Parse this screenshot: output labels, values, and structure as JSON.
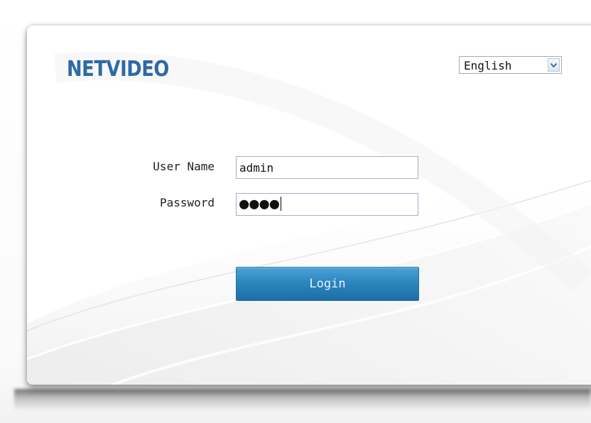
{
  "brand": {
    "logo_text": "NETVIDEO",
    "color": "#2d6aa5"
  },
  "language": {
    "selected": "English",
    "icon": "chevron-down-icon"
  },
  "form": {
    "username_label": "User Name",
    "username_value": "admin",
    "password_label": "Password",
    "password_masked": "●●●●",
    "login_label": "Login"
  },
  "colors": {
    "button_top": "#4aa3d6",
    "button_bottom": "#1c6ea6",
    "field_border": "#9fb3c8"
  }
}
